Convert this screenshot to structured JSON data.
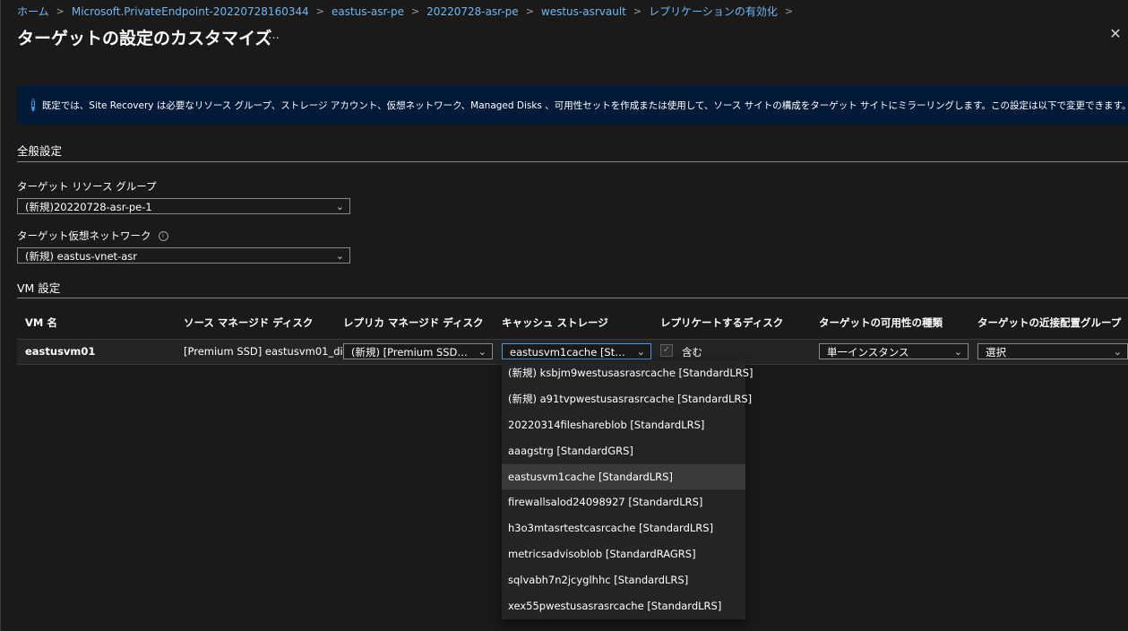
{
  "breadcrumb": [
    "ホーム",
    "Microsoft.PrivateEndpoint-20220728160344",
    "eastus-asr-pe",
    "20220728-asr-pe",
    "westus-asrvault",
    "レプリケーションの有効化"
  ],
  "page_title": "ターゲットの設定のカスタマイズ",
  "more_label": "…",
  "close_label": "✕",
  "info_icon": "i",
  "info_text": "既定では、Site Recovery は必要なリソース グループ、ストレージ アカウント、仮想ネットワーク、Managed Disks 、可用性セットを作成または使用して、ソース サイトの構成をターゲット サイトにミラーリングします。この設定は以下で変更できます。",
  "general": {
    "title": "全般設定",
    "rg_label": "ターゲット リソース グループ",
    "rg_value": "(新規)20220728-asr-pe-1",
    "vnet_label": "ターゲット仮想ネットワーク",
    "vnet_value": "(新規) eastus-vnet-asr"
  },
  "vm": {
    "title": "VM 設定",
    "headers": [
      "VM 名",
      "ソース マネージド ディスク",
      "レプリカ マネージド ディスク",
      "キャッシュ ストレージ",
      "レプリケートするディスク",
      "ターゲットの可用性の種類",
      "ターゲットの近接配置グループ"
    ],
    "row": {
      "name": "eastusvm01",
      "source_disk": "[Premium SSD] eastusvm01_di...",
      "replica_disk": "(新規) [Premium SSD] e...",
      "cache_storage": "eastusvm1cache [Stand...",
      "replicate_check": "✓",
      "replicate_label": "含む",
      "availability": "単一インスタンス",
      "proximity": "選択"
    }
  },
  "cache_options": [
    "(新規) ksbjm9westusasrasrcache [StandardLRS]",
    "(新規) a91tvpwestusasrasrcache [StandardLRS]",
    "20220314fileshareblob [StandardLRS]",
    "aaagstrg [StandardGRS]",
    "eastusvm1cache [StandardLRS]",
    "firewallsalod24098927 [StandardLRS]",
    "h3o3mtasrtestcasrcache [StandardLRS]",
    "metricsadvisoblob [StandardRAGRS]",
    "sqlvabh7n2jcyglhhc [StandardLRS]",
    "xex55pwestusasrasrcache [StandardLRS]"
  ],
  "cache_selected": "eastusvm1cache [StandardLRS]",
  "colors": {
    "link": "#6cb8f6",
    "accent": "#3aa0f3",
    "info_bg": "#001a38",
    "page_bg": "#1b1a19"
  }
}
